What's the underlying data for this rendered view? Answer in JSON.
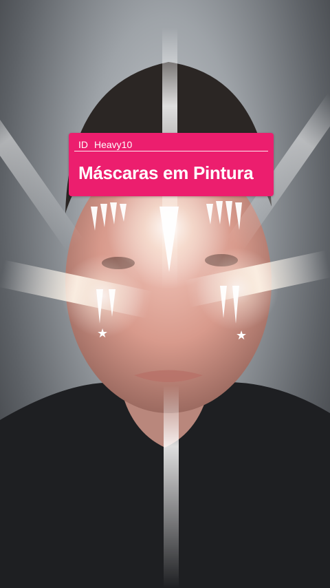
{
  "overlay": {
    "id_prefix": "ID",
    "id_value": "Heavy10",
    "title": "Máscaras em Pintura"
  },
  "photo": {
    "subject": "selfie-with-face-paint-filter",
    "effect": "light-rays-and-white-face-paint",
    "accent_color": "#ec1e6e"
  }
}
